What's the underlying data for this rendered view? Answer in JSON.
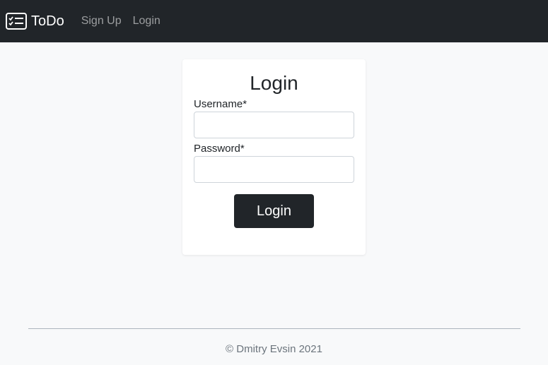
{
  "navbar": {
    "brand": "ToDo",
    "brand_icon": "card-checklist-icon",
    "links": [
      "Sign Up",
      "Login"
    ]
  },
  "login_form": {
    "title": "Login",
    "username_label": "Username*",
    "username_value": "",
    "password_label": "Password*",
    "password_value": "",
    "submit_label": "Login"
  },
  "footer": {
    "text": "© Dmitry Evsin 2021"
  },
  "colors": {
    "navbar_bg": "#212529",
    "page_bg": "#f8f9fa",
    "button_bg": "#212529",
    "nav_link": "#a6a8aa"
  }
}
